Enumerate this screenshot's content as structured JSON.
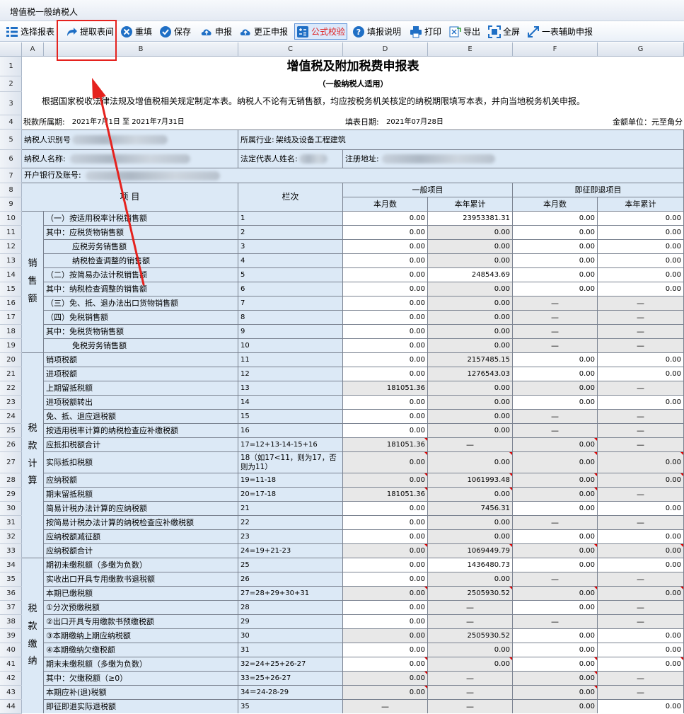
{
  "window": {
    "title": "增值税一般纳税人"
  },
  "toolbar": {
    "items": [
      {
        "label": "选择报表",
        "icon": "list-icon"
      },
      {
        "label": "提取表间",
        "icon": "redo-arrow-icon"
      },
      {
        "label": "重填",
        "icon": "close-circle-icon"
      },
      {
        "label": "保存",
        "icon": "check-circle-icon"
      },
      {
        "label": "申报",
        "icon": "cloud-upload-icon"
      },
      {
        "label": "更正申报",
        "icon": "cloud-upload-icon"
      },
      {
        "label": "公式校验",
        "icon": "calculator-icon"
      },
      {
        "label": "填报说明",
        "icon": "help-icon"
      },
      {
        "label": "打印",
        "icon": "printer-icon"
      },
      {
        "label": "导出",
        "icon": "export-icon"
      },
      {
        "label": "全屏",
        "icon": "fullscreen-icon"
      },
      {
        "label": "一表辅助申报",
        "icon": "expand-arrows-icon"
      }
    ]
  },
  "sheet": {
    "columns": [
      "A",
      "B",
      "C",
      "D",
      "E",
      "F",
      "G"
    ],
    "row_numbers": [
      "1",
      "2",
      "3",
      "4",
      "5",
      "6",
      "7",
      "8",
      "9",
      "10",
      "11",
      "12",
      "13",
      "14",
      "15",
      "16",
      "17",
      "18",
      "19",
      "20",
      "21",
      "22",
      "23",
      "24",
      "25",
      "26",
      "27",
      "28",
      "29",
      "30",
      "31",
      "32",
      "33",
      "34",
      "35",
      "36",
      "37",
      "38",
      "39",
      "40",
      "41",
      "42",
      "43",
      "44"
    ]
  },
  "form": {
    "title": "增值税及附加税费申报表",
    "subtitle": "（一般纳税人适用）",
    "notice": "根据国家税收法律法规及增值税相关规定制定本表。纳税人不论有无销售额，均应按税务机关核定的纳税期限填写本表，并向当地税务机关申报。",
    "period_label": "税款所属期:",
    "period_value": "2021年7月1日 至 2021年7月31日",
    "fill_date_label": "填表日期:",
    "fill_date_value": "2021年07月28日",
    "unit_label": "金额单位：元至角分",
    "taxpayer_id_label": "纳税人识别号",
    "industry_label": "所属行业:",
    "industry_value": "架线及设备工程建筑",
    "taxpayer_name_label": "纳税人名称:",
    "legal_rep_label": "法定代表人姓名:",
    "reg_addr_label": "注册地址:",
    "bank_label": "开户银行及账号:",
    "header_item": "项    目",
    "header_lanci": "栏次",
    "header_general": "一般项目",
    "header_immediate": "即征即退项目",
    "header_month": "本月数",
    "header_ytd": "本年累计",
    "cat_sales": [
      "销",
      "售",
      "额"
    ],
    "cat_tax": [
      "税",
      "款",
      "计",
      "算"
    ],
    "cat_pay": [
      "税",
      "款",
      "缴",
      "纳"
    ]
  },
  "rows": [
    {
      "item": "（一）按适用税率计税销售额",
      "lanci": "1",
      "d": "0.00",
      "e": "23953381.31",
      "f": "0.00",
      "g": "0.00"
    },
    {
      "item": "其中：应税货物销售额",
      "lanci": "2",
      "d": "0.00",
      "e": "0.00",
      "f": "0.00",
      "g": "0.00"
    },
    {
      "item": "应税劳务销售额",
      "lanci": "3",
      "d": "0.00",
      "e": "0.00",
      "f": "0.00",
      "g": "0.00"
    },
    {
      "item": "纳税检查调整的销售额",
      "lanci": "4",
      "d": "0.00",
      "e": "0.00",
      "f": "0.00",
      "g": "0.00"
    },
    {
      "item": "（二）按简易办法计税销售额",
      "lanci": "5",
      "d": "0.00",
      "e": "248543.69",
      "f": "0.00",
      "g": "0.00"
    },
    {
      "item": "其中：纳税检查调整的销售额",
      "lanci": "6",
      "d": "0.00",
      "e": "0.00",
      "f": "0.00",
      "g": "0.00"
    },
    {
      "item": "（三）免、抵、退办法出口货物销售额",
      "lanci": "7",
      "d": "0.00",
      "e": "0.00",
      "f": "—",
      "g": "—"
    },
    {
      "item": "（四）免税销售额",
      "lanci": "8",
      "d": "0.00",
      "e": "0.00",
      "f": "—",
      "g": "—"
    },
    {
      "item": "其中：免税货物销售额",
      "lanci": "9",
      "d": "0.00",
      "e": "0.00",
      "f": "—",
      "g": "—"
    },
    {
      "item": "免税劳务销售额",
      "lanci": "10",
      "d": "0.00",
      "e": "0.00",
      "f": "—",
      "g": "—"
    },
    {
      "item": "销项税额",
      "lanci": "11",
      "d": "0.00",
      "e": "2157485.15",
      "f": "0.00",
      "g": "0.00"
    },
    {
      "item": "进项税额",
      "lanci": "12",
      "d": "0.00",
      "e": "1276543.03",
      "f": "0.00",
      "g": "0.00"
    },
    {
      "item": "上期留抵税额",
      "lanci": "13",
      "d": "181051.36",
      "e": "0.00",
      "f": "0.00",
      "g": "—"
    },
    {
      "item": "进项税额转出",
      "lanci": "14",
      "d": "0.00",
      "e": "0.00",
      "f": "0.00",
      "g": "0.00"
    },
    {
      "item": "免、抵、退应退税额",
      "lanci": "15",
      "d": "0.00",
      "e": "0.00",
      "f": "—",
      "g": "—"
    },
    {
      "item": "按适用税率计算的纳税检查应补缴税额",
      "lanci": "16",
      "d": "0.00",
      "e": "0.00",
      "f": "—",
      "g": "—"
    },
    {
      "item": "应抵扣税额合计",
      "lanci": "17=12+13-14-15+16",
      "d": "181051.36",
      "e": "—",
      "f": "0.00",
      "g": "—"
    },
    {
      "item": "实际抵扣税额",
      "lanci": "18（如17<11，则为17，否则为11）",
      "d": "0.00",
      "e": "0.00",
      "f": "0.00",
      "g": "0.00"
    },
    {
      "item": "应纳税额",
      "lanci": "19=11-18",
      "d": "0.00",
      "e": "1061993.48",
      "f": "0.00",
      "g": "0.00"
    },
    {
      "item": "期末留抵税额",
      "lanci": "20=17-18",
      "d": "181051.36",
      "e": "0.00",
      "f": "0.00",
      "g": "—"
    },
    {
      "item": "简易计税办法计算的应纳税额",
      "lanci": "21",
      "d": "0.00",
      "e": "7456.31",
      "f": "0.00",
      "g": "0.00"
    },
    {
      "item": "按简易计税办法计算的纳税检查应补缴税额",
      "lanci": "22",
      "d": "0.00",
      "e": "0.00",
      "f": "—",
      "g": "—"
    },
    {
      "item": "应纳税额减征额",
      "lanci": "23",
      "d": "0.00",
      "e": "0.00",
      "f": "0.00",
      "g": "0.00"
    },
    {
      "item": "应纳税额合计",
      "lanci": "24=19+21-23",
      "d": "0.00",
      "e": "1069449.79",
      "f": "0.00",
      "g": "0.00"
    },
    {
      "item": "期初未缴税额（多缴为负数）",
      "lanci": "25",
      "d": "0.00",
      "e": "1436480.73",
      "f": "0.00",
      "g": "0.00"
    },
    {
      "item": "实收出口开具专用缴款书退税额",
      "lanci": "26",
      "d": "0.00",
      "e": "0.00",
      "f": "—",
      "g": "—"
    },
    {
      "item": "本期已缴税额",
      "lanci": "27=28+29+30+31",
      "d": "0.00",
      "e": "2505930.52",
      "f": "0.00",
      "g": "0.00"
    },
    {
      "item": "①分次预缴税额",
      "lanci": "28",
      "d": "0.00",
      "e": "—",
      "f": "0.00",
      "g": "—"
    },
    {
      "item": "②出口开具专用缴款书预缴税额",
      "lanci": "29",
      "d": "0.00",
      "e": "—",
      "f": "—",
      "g": "—"
    },
    {
      "item": "③本期缴纳上期应纳税额",
      "lanci": "30",
      "d": "0.00",
      "e": "2505930.52",
      "f": "0.00",
      "g": "0.00"
    },
    {
      "item": "④本期缴纳欠缴税额",
      "lanci": "31",
      "d": "0.00",
      "e": "0.00",
      "f": "0.00",
      "g": "0.00"
    },
    {
      "item": "期末未缴税额（多缴为负数）",
      "lanci": "32=24+25+26-27",
      "d": "0.00",
      "e": "0.00",
      "f": "0.00",
      "g": "0.00"
    },
    {
      "item": "其中：欠缴税额（≥0）",
      "lanci": "33=25+26-27",
      "d": "0.00",
      "e": "—",
      "f": "0.00",
      "g": "—"
    },
    {
      "item": "本期应补(退)税额",
      "lanci": "34＝24-28-29",
      "d": "0.00",
      "e": "—",
      "f": "0.00",
      "g": "—"
    },
    {
      "item": "即征即退实际退税额",
      "lanci": "35",
      "d": "—",
      "e": "—",
      "f": "0.00",
      "g": "0.00"
    }
  ]
}
